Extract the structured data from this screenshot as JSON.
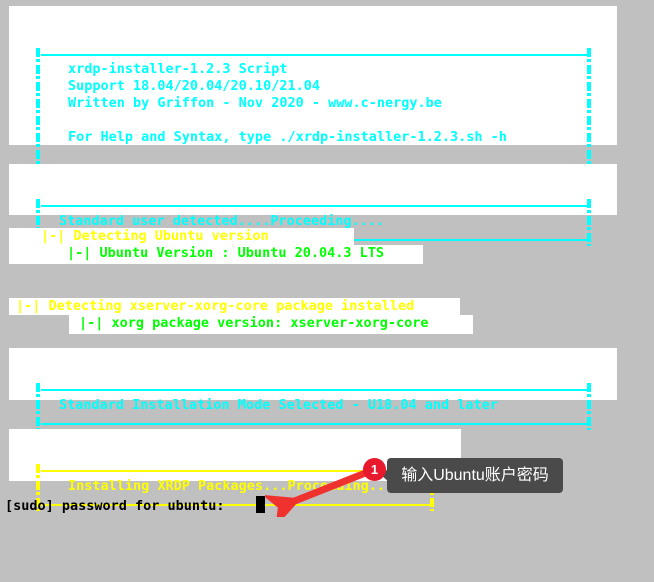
{
  "terminal": {
    "background_color": "#c0c0c0",
    "text_bg_color": "#ffffff",
    "colors": {
      "cyan": "#00ffff",
      "yellow": "#ffff00",
      "green": "#00ff00",
      "black": "#000000",
      "annotation_red": "#e8192c",
      "tooltip_bg": "#4a4a4a"
    },
    "banner": {
      "title": "xrdp-installer-1.2.3 Script",
      "support": "Support 18.04/20.04/20.10/21.04",
      "author": "Written by Griffon - Nov 2020 - www.c-nergy.be",
      "help": "For Help and Syntax, type ./xrdp-installer-1.2.3.sh -h",
      "frame_char": "!",
      "rule": "-------------------------------------------------------------------"
    },
    "messages": {
      "standard_user": "Standard user detected....Proceeding....",
      "detect_ubuntu_label": "|-| Detecting Ubuntu version",
      "ubuntu_version": "|-| Ubuntu Version : Ubuntu 20.04.3 LTS",
      "detect_xorg_label": "|-| Detecting xserver-xorg-core package installed",
      "xorg_version": "|-| xorg package version: xserver-xorg-core",
      "install_mode": "Standard Installation Mode Selected - U18.04 and later",
      "installing_xrdp": "Installing XRDP Packages...Proceeding...",
      "sudo_prompt": "[sudo] password for ubuntu: "
    },
    "rules": {
      "cyan_rule_long": "-------------------------------------------------------------------",
      "yellow_rule": "---------------------------------------------"
    }
  },
  "annotation": {
    "step_number": "1",
    "tooltip_text": "输入Ubuntu账户密码",
    "arrow": "red-arrow-pointing-down-left"
  }
}
